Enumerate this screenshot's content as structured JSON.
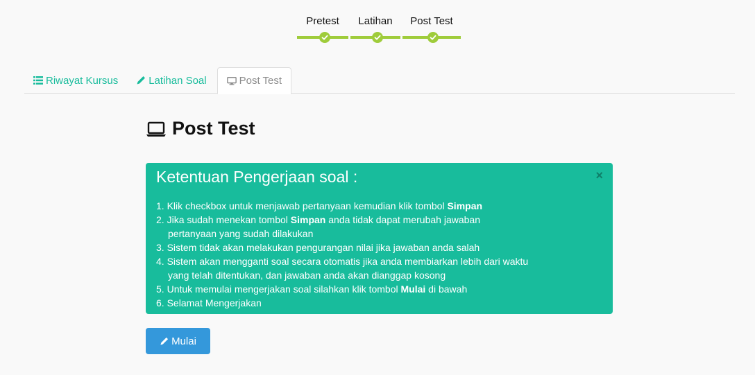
{
  "steps": [
    {
      "label": "Pretest",
      "done": true
    },
    {
      "label": "Latihan",
      "done": true
    },
    {
      "label": "Post Test",
      "done": true
    }
  ],
  "tabs": [
    {
      "label": "Riwayat Kursus",
      "icon": "list-icon",
      "active": false
    },
    {
      "label": "Latihan Soal",
      "icon": "pencil-icon",
      "active": false
    },
    {
      "label": "Post Test",
      "icon": "desktop-icon",
      "active": true
    }
  ],
  "heading": {
    "title": "Post Test",
    "icon": "laptop-icon"
  },
  "alert": {
    "title": "Ketentuan Pengerjaan soal :",
    "close": "×",
    "rules": [
      {
        "n": "1.",
        "pre": "Klik checkbox untuk menjawab pertanyaan kemudian klik tombol ",
        "bold": "Simpan",
        "post": "",
        "cont": ""
      },
      {
        "n": "2.",
        "pre": "Jika sudah menekan tombol ",
        "bold": "Simpan",
        "post": " anda tidak dapat merubah jawaban",
        "cont": "pertanyaan yang sudah dilakukan"
      },
      {
        "n": "3.",
        "pre": "Sistem tidak akan melakukan pengurangan nilai jika jawaban anda salah",
        "bold": "",
        "post": "",
        "cont": ""
      },
      {
        "n": "4.",
        "pre": "Sistem akan mengganti soal secara otomatis jika anda membiarkan lebih dari waktu",
        "bold": "",
        "post": "",
        "cont": "yang telah ditentukan, dan jawaban anda akan dianggap kosong"
      },
      {
        "n": "5.",
        "pre": "Untuk memulai mengerjakan soal silahkan klik tombol ",
        "bold": "Mulai",
        "post": " di bawah",
        "cont": ""
      },
      {
        "n": "6.",
        "pre": "Selamat Mengerjakan",
        "bold": "",
        "post": "",
        "cont": ""
      }
    ]
  },
  "start_button": {
    "label": "Mulai",
    "icon": "pencil-icon"
  },
  "colors": {
    "accent": "#18bc9c",
    "step": "#9fcc3b",
    "primary": "#3498db"
  }
}
